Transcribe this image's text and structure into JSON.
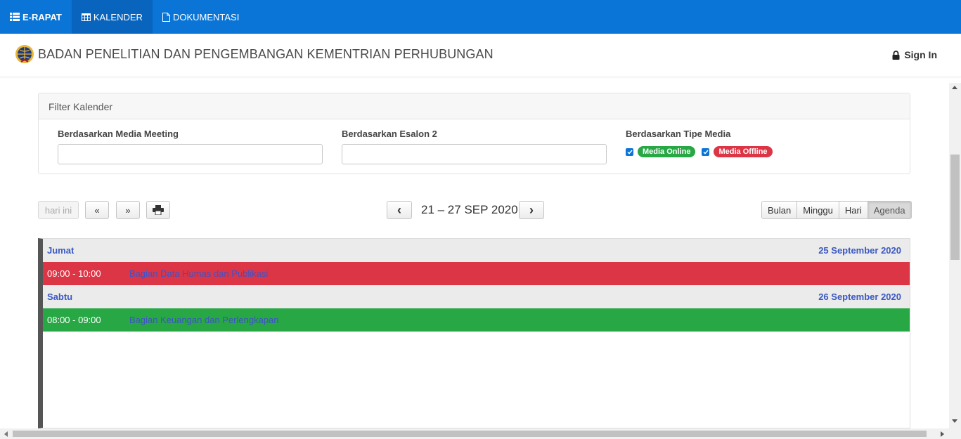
{
  "nav": {
    "brand": "E-RAPAT",
    "items": [
      {
        "label": "KALENDER",
        "active": true
      },
      {
        "label": "DOKUMENTASI",
        "active": false
      }
    ]
  },
  "header": {
    "title": "BADAN PENELITIAN DAN PENGEMBANGAN KEMENTRIAN PERHUBUNGAN",
    "signin": "Sign In"
  },
  "filter": {
    "title": "Filter Kalender",
    "media_meeting_label": "Berdasarkan Media Meeting",
    "esalon_label": "Berdasarkan Esalon 2",
    "tipe_media_label": "Berdasarkan Tipe Media",
    "media_online": "Media Online",
    "media_offline": "Media Offline"
  },
  "toolbar": {
    "today": "hari ini",
    "prev_year": "«",
    "next_year": "»",
    "prev": "‹",
    "next": "›",
    "range": "21 – 27 SEP 2020",
    "views": [
      "Bulan",
      "Minggu",
      "Hari",
      "Agenda"
    ],
    "active_view": "Agenda"
  },
  "agenda": [
    {
      "day": "Jumat",
      "date": "25 September 2020",
      "events": [
        {
          "time": "09:00 - 10:00",
          "title": "Bagian Data Humas dan Publikasi",
          "type": "offline"
        }
      ]
    },
    {
      "day": "Sabtu",
      "date": "26 September 2020",
      "events": [
        {
          "time": "08:00 - 09:00",
          "title": "Bagian Keuangan dan Perlengkapan",
          "type": "online"
        }
      ]
    }
  ],
  "colors": {
    "nav": "#0a75d6",
    "online": "#28a745",
    "offline": "#dc3545",
    "day_text": "#3b59c2"
  }
}
